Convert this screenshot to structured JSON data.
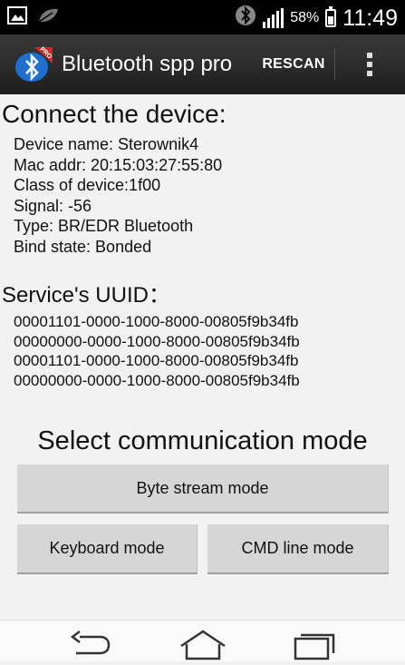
{
  "status_bar": {
    "battery_percent": "58%",
    "battery_level": 0.58,
    "clock": "11:49",
    "icons": [
      "image-icon",
      "leaf-icon",
      "bluetooth-icon",
      "signal-icon",
      "battery-icon"
    ]
  },
  "action_bar": {
    "title": "Bluetooth spp pro",
    "icon_badge": "PRO",
    "rescan_label": "RESCAN",
    "overflow_icon": "more-vert-icon"
  },
  "connect": {
    "heading": "Connect the device:",
    "lines": [
      "Device name: Sterownik4",
      "Mac addr: 20:15:03:27:55:80",
      "Class of device:1f00",
      "Signal: -56",
      "Type: BR/EDR Bluetooth",
      "Bind state: Bonded"
    ]
  },
  "service": {
    "heading": "Service's UUID：",
    "uuids": [
      "00001101-0000-1000-8000-00805f9b34fb",
      "00000000-0000-1000-8000-00805f9b34fb",
      "00001101-0000-1000-8000-00805f9b34fb",
      "00000000-0000-1000-8000-00805f9b34fb"
    ]
  },
  "mode": {
    "heading": "Select communication mode",
    "byte_stream": "Byte stream mode",
    "keyboard": "Keyboard mode",
    "cmd_line": "CMD line mode"
  },
  "nav": {
    "icons": [
      "back-icon",
      "home-icon",
      "recent-apps-icon"
    ]
  },
  "colors": {
    "action_bar": "#2b2b2b",
    "background": "#f2f2f2",
    "button": "#d6d6d6",
    "icon_blue": "#1f6fd1",
    "badge_red": "#d0262c"
  }
}
